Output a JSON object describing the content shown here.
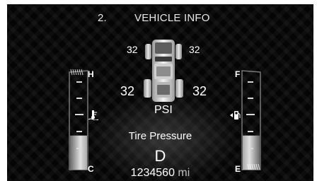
{
  "header": {
    "page_number": "2.",
    "title": "VEHICLE INFO"
  },
  "tire_pressure": {
    "front_left": "32",
    "front_right": "32",
    "rear_left": "32",
    "rear_right": "32",
    "unit": "PSI"
  },
  "message": "Tire Pressure",
  "gear": "D",
  "odometer": {
    "value": "1234560",
    "unit": "mi"
  },
  "temp_gauge": {
    "high_label": "H",
    "low_label": "C",
    "icon": "coolant-temperature-icon",
    "level": 0.35
  },
  "fuel_gauge": {
    "full_label": "F",
    "empty_label": "E",
    "icon": "fuel-pump-icon",
    "level": 0.35
  },
  "colors": {
    "background": "#050505",
    "text": "#ffffff",
    "gauge": "#d9d9d9"
  }
}
